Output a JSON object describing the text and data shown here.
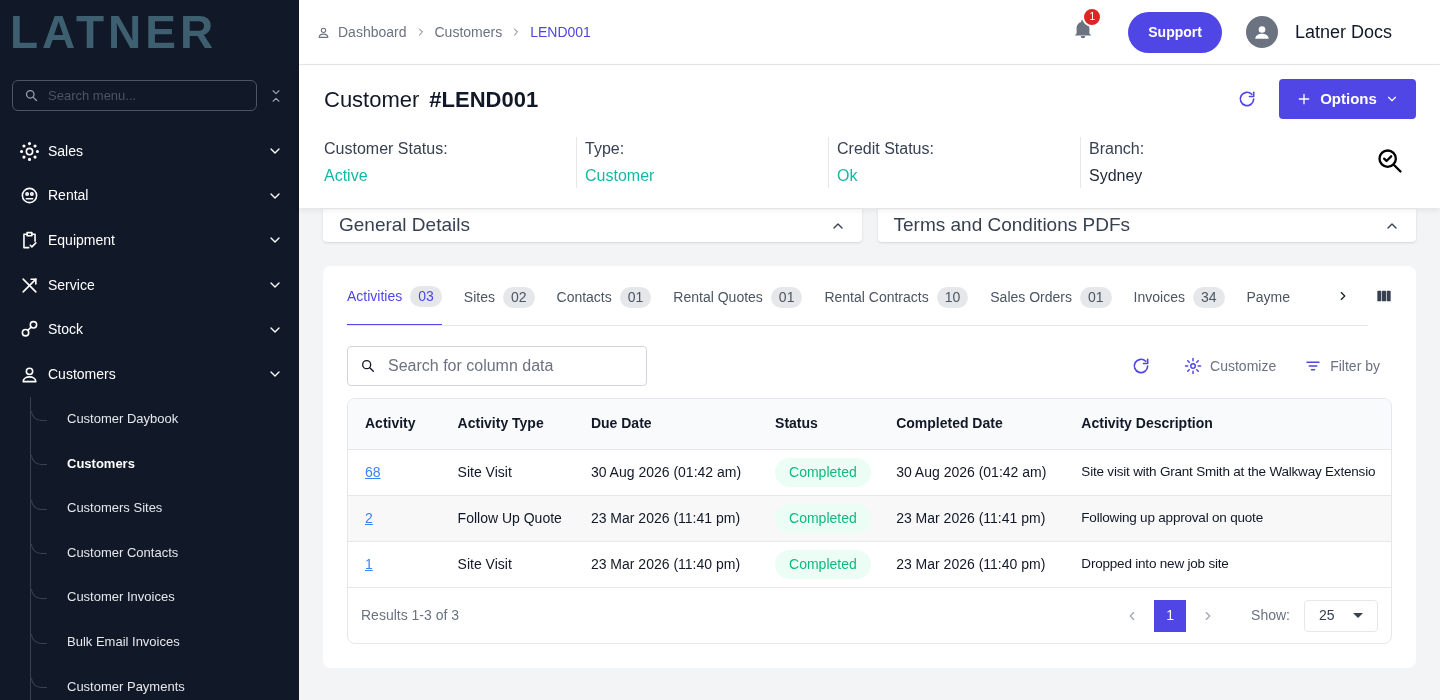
{
  "sidebar": {
    "logo": "LATNER",
    "search": {
      "placeholder": "Search menu..."
    },
    "items": [
      {
        "label": "Sales",
        "kind": "sales"
      },
      {
        "label": "Rental",
        "kind": "rental"
      },
      {
        "label": "Equipment",
        "kind": "equipment"
      },
      {
        "label": "Service",
        "kind": "service"
      },
      {
        "label": "Stock",
        "kind": "stock"
      },
      {
        "label": "Customers",
        "kind": "customers",
        "children": [
          {
            "label": "Customer Daybook",
            "selected": false
          },
          {
            "label": "Customers",
            "selected": true
          },
          {
            "label": "Customers Sites",
            "selected": false
          },
          {
            "label": "Customer Contacts",
            "selected": false
          },
          {
            "label": "Customer Invoices",
            "selected": false
          },
          {
            "label": "Bulk Email Invoices",
            "selected": false
          },
          {
            "label": "Customer Payments",
            "selected": false
          }
        ]
      }
    ]
  },
  "header": {
    "breadcrumbs": [
      "Dashboard",
      "Customers",
      "LEND001"
    ],
    "notifications": "1",
    "support": "Support",
    "user": "Latner Docs"
  },
  "customer": {
    "title": "Customer",
    "id": "#LEND001",
    "options": "Options",
    "fields": [
      {
        "label": "Customer Status:",
        "value": "Active",
        "highlight": true
      },
      {
        "label": "Type:",
        "value": "Customer",
        "highlight": true
      },
      {
        "label": "Credit Status:",
        "value": "Ok",
        "highlight": true
      },
      {
        "label": "Branch:",
        "value": "Sydney",
        "highlight": false
      }
    ]
  },
  "panels": [
    {
      "title": "General Details"
    },
    {
      "title": "Terms and Conditions PDFs"
    }
  ],
  "tabs": [
    {
      "label": "Activities",
      "count": "03",
      "selected": true
    },
    {
      "label": "Sites",
      "count": "02",
      "selected": false
    },
    {
      "label": "Contacts",
      "count": "01",
      "selected": false
    },
    {
      "label": "Rental Quotes",
      "count": "01",
      "selected": false
    },
    {
      "label": "Rental Contracts",
      "count": "10",
      "selected": false
    },
    {
      "label": "Sales Orders",
      "count": "01",
      "selected": false
    },
    {
      "label": "Invoices",
      "count": "34",
      "selected": false
    },
    {
      "label": "Payme"
    }
  ],
  "toolbar": {
    "search": {
      "placeholder": "Search for column data"
    },
    "customize": "Customize",
    "filter": "Filter by"
  },
  "table": {
    "columns": [
      "Activity",
      "Activity Type",
      "Due Date",
      "Status",
      "Completed Date",
      "Activity Description"
    ],
    "rows": [
      [
        "68",
        "Site Visit",
        "30 Aug 2026 (01:42 am)",
        "Completed",
        "30 Aug 2026 (01:42 am)",
        "Site visit with Grant Smith at the Walkway Extensio"
      ],
      [
        "2",
        "Follow Up Quote",
        "23 Mar 2026 (11:41 pm)",
        "Completed",
        "23 Mar 2026 (11:41 pm)",
        "Following up approval on quote"
      ],
      [
        "1",
        "Site Visit",
        "23 Mar 2026 (11:40 pm)",
        "Completed",
        "23 Mar 2026 (11:40 pm)",
        "Dropped into new job site"
      ]
    ]
  },
  "pagination": {
    "results": "Results 1-3 of 3",
    "pages": [
      {
        "label": "1",
        "selected": true
      }
    ],
    "show_label": "Show:",
    "page_size": "25"
  }
}
